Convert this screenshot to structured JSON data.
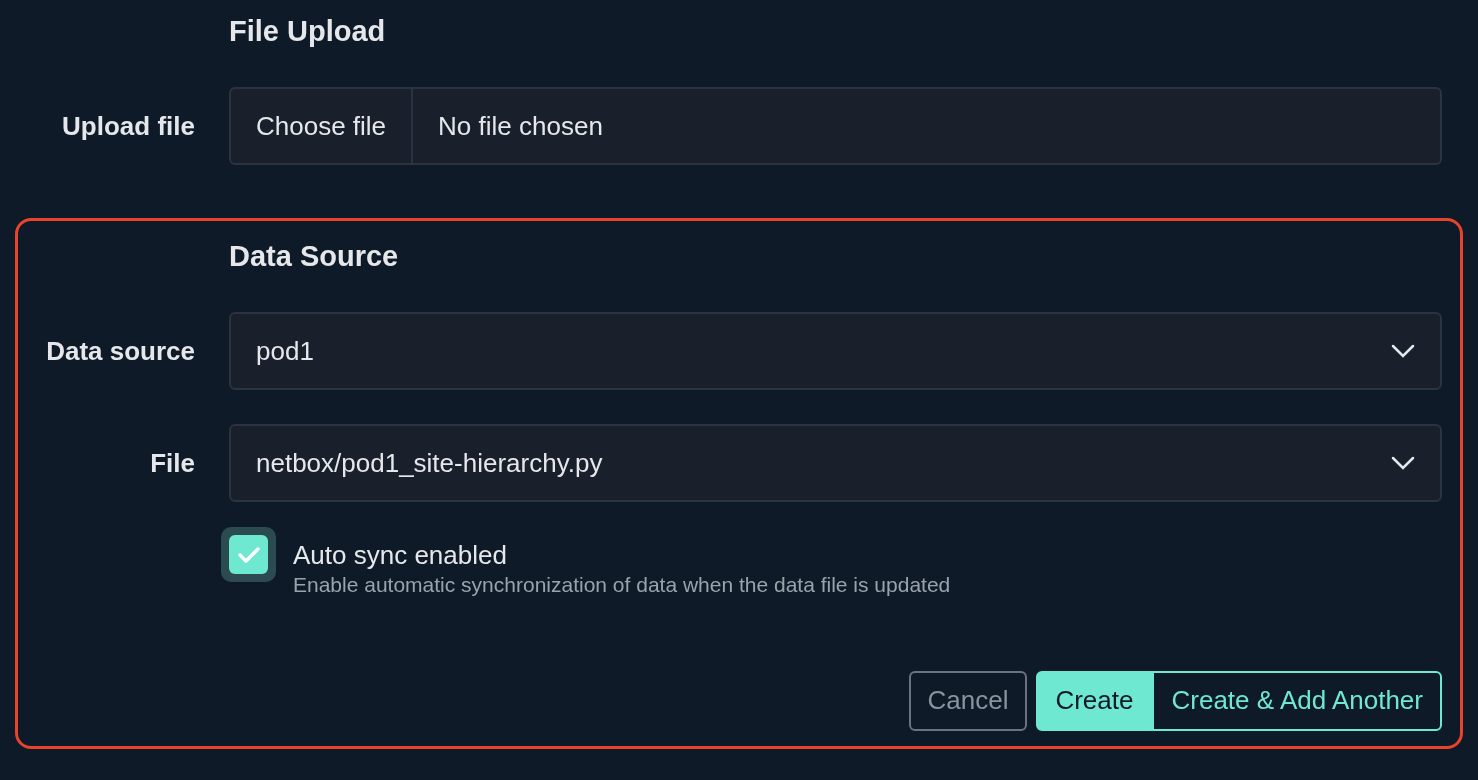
{
  "sections": [
    {
      "title": "File Upload",
      "highlighted": false,
      "fields": [
        {
          "kind": "file",
          "label": "Upload file",
          "button": "Choose file",
          "value": "No file chosen"
        }
      ]
    },
    {
      "title": "Data Source",
      "highlighted": true,
      "fields": [
        {
          "kind": "select",
          "label": "Data source",
          "value": "pod1"
        },
        {
          "kind": "select",
          "label": "File",
          "value": "netbox/pod1_site-hierarchy.py"
        },
        {
          "kind": "checkbox",
          "label": "Auto sync enabled",
          "help": "Enable automatic synchronization of data when the data file is updated",
          "checked": true
        }
      ],
      "buttons": [
        {
          "kind": "secondary",
          "label": "Cancel"
        },
        {
          "kind": "primary",
          "label": "Create"
        },
        {
          "kind": "outline",
          "label": "Create & Add Another"
        }
      ]
    }
  ]
}
